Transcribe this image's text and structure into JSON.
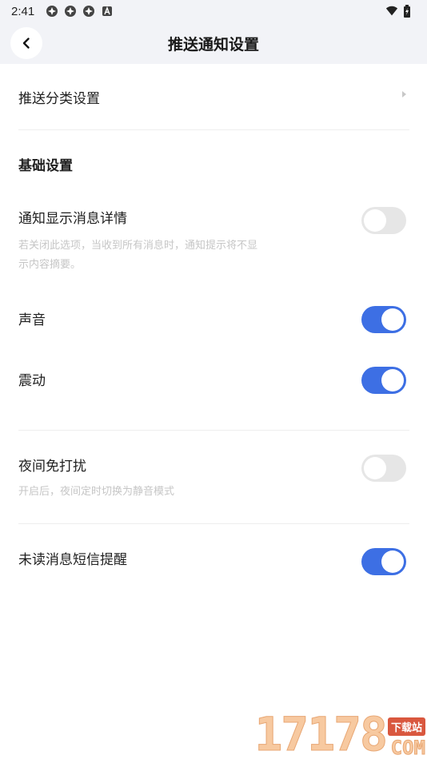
{
  "status_bar": {
    "time": "2:41",
    "icons": [
      "app-icon",
      "app-icon",
      "app-icon",
      "notification-a-icon"
    ],
    "right_icons": [
      "wifi-icon",
      "battery-icon"
    ]
  },
  "header": {
    "title": "推送通知设置",
    "back_icon": "chevron-left-icon"
  },
  "push_category": {
    "label": "推送分类设置"
  },
  "basic": {
    "title": "基础设置",
    "items": [
      {
        "label": "通知显示消息详情",
        "desc": "若关闭此选项，当收到所有消息时，通知提示将不显示内容摘要。",
        "enabled": false
      },
      {
        "label": "声音",
        "enabled": true
      },
      {
        "label": "震动",
        "enabled": true
      }
    ]
  },
  "night": {
    "label": "夜间免打扰",
    "desc": "开启后，夜间定时切换为静音模式",
    "enabled": false
  },
  "sms": {
    "label": "未读消息短信提醒",
    "enabled": true
  },
  "watermark": {
    "digits": "17178",
    "badge": "下载站",
    "suffix": "COM"
  },
  "colors": {
    "accent": "#3d6fe4",
    "toggle_off": "#e6e6e6",
    "header_bg": "#f2f3f7"
  }
}
